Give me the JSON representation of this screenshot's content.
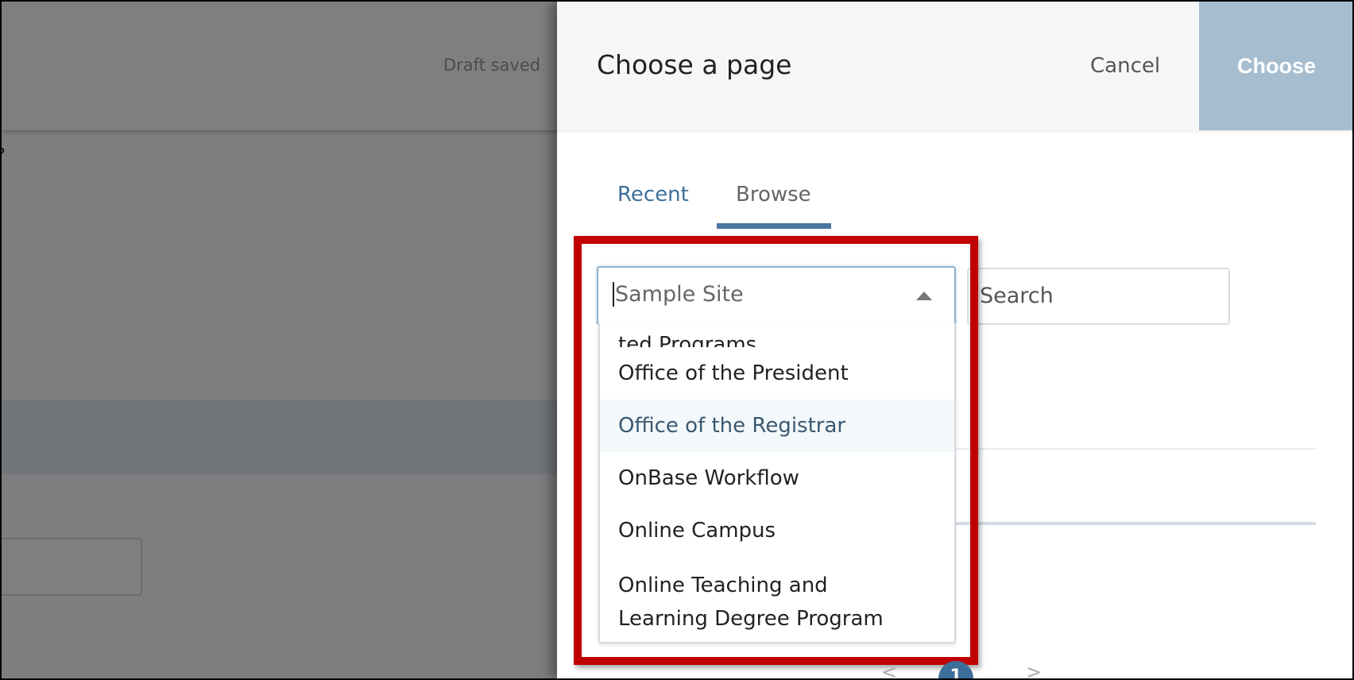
{
  "background": {
    "status_text": "Draft saved",
    "help_glyph": "?"
  },
  "dialog": {
    "title": "Choose a page",
    "cancel_label": "Cancel",
    "choose_label": "Choose",
    "tabs": [
      {
        "label": "Recent",
        "active": false
      },
      {
        "label": "Browse",
        "active": true
      }
    ],
    "site_select": {
      "value": "Sample Site",
      "expanded": true,
      "icon": "triangle-up-icon"
    },
    "search": {
      "placeholder": "Search"
    },
    "options": [
      {
        "label": "ted Programs",
        "highlighted": false
      },
      {
        "label": "Office of the President",
        "highlighted": false
      },
      {
        "label": "Office of the Registrar",
        "highlighted": true
      },
      {
        "label": "OnBase Workflow",
        "highlighted": false
      },
      {
        "label": "Online Campus",
        "highlighted": false
      },
      {
        "label": "Online Teaching and Learning Degree Program",
        "highlighted": false
      }
    ],
    "pagination": {
      "prev": "<",
      "current": "1",
      "next": ">"
    }
  },
  "colors": {
    "accent": "#4a76a0",
    "choose_button": "#a6bdd0",
    "highlight_box": "#c00000",
    "overlay": "#7d7e80"
  }
}
